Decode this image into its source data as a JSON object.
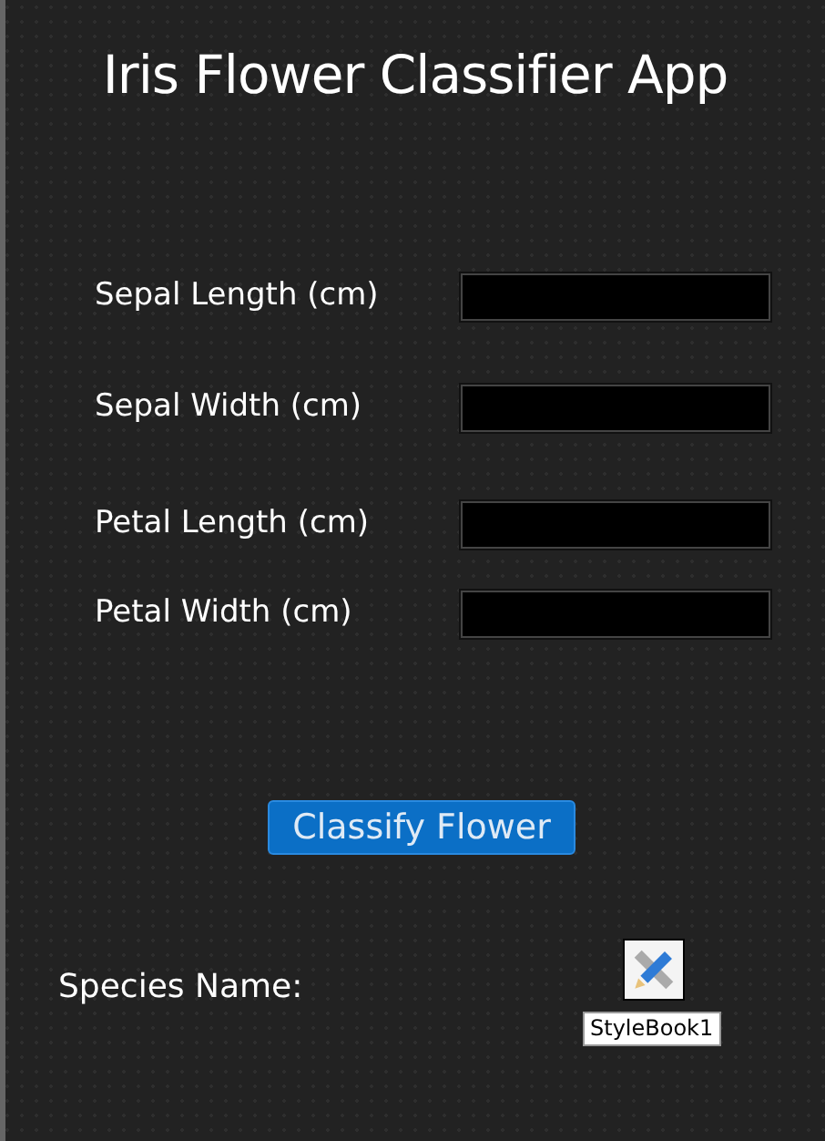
{
  "title": "Iris Flower Classifier App",
  "fields": [
    {
      "label": "Sepal Length (cm)"
    },
    {
      "label": "Sepal Width (cm)"
    },
    {
      "label": "Petal Length (cm)"
    },
    {
      "label": "Petal Width (cm)"
    }
  ],
  "button": "Classify Flower",
  "result_label": "Species Name:",
  "component": {
    "label": "StyleBook1"
  }
}
